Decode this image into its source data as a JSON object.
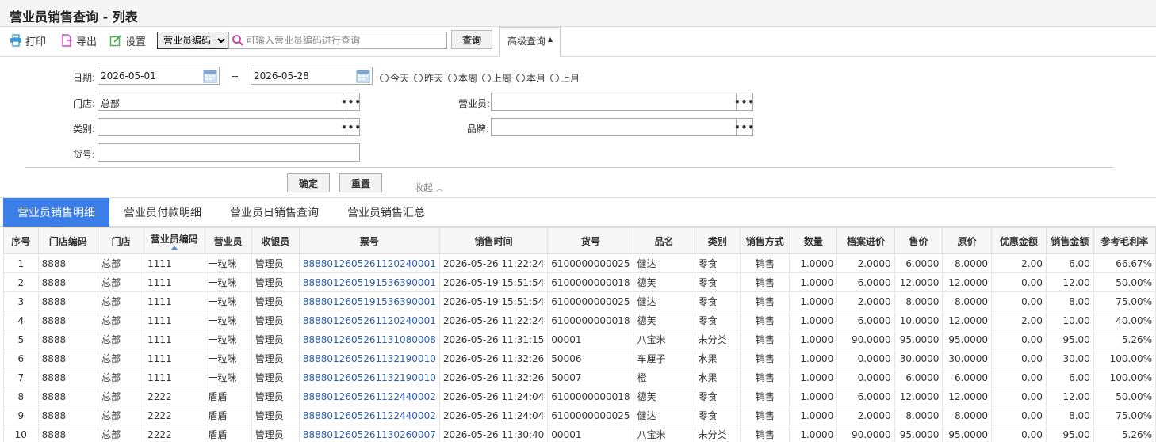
{
  "title": "营业员销售查询 - 列表",
  "toolbar": {
    "print": "打印",
    "export": "导出",
    "settings": "设置",
    "field_select": "营业员编码",
    "search_placeholder": "可输入营业员编码进行查询",
    "query_button": "查询",
    "advanced_tab": "高级查询"
  },
  "form": {
    "date_label": "日期:",
    "date_from": "2026-05-01",
    "date_sep": "--",
    "date_to": "2026-05-28",
    "quick_ranges": [
      "今天",
      "昨天",
      "本周",
      "上周",
      "本月",
      "上月"
    ],
    "store_label": "门店:",
    "store_value": "总部",
    "clerk_label": "营业员:",
    "clerk_value": "",
    "category_label": "类别:",
    "category_value": "",
    "brand_label": "品牌:",
    "brand_value": "",
    "sku_label": "货号:",
    "sku_value": "",
    "ok_button": "确定",
    "reset_button": "重置",
    "collapse": "收起"
  },
  "tabs": [
    "营业员销售明细",
    "营业员付款明细",
    "营业员日销售查询",
    "营业员销售汇总"
  ],
  "table": {
    "headers": [
      "序号",
      "门店编码",
      "门店",
      "营业员编码",
      "营业员",
      "收银员",
      "票号",
      "销售时间",
      "货号",
      "品名",
      "类别",
      "销售方式",
      "数量",
      "档案进价",
      "售价",
      "原价",
      "优惠金额",
      "销售金额",
      "参考毛利率"
    ],
    "rows": [
      [
        "1",
        "8888",
        "总部",
        "1111",
        "一粒咪",
        "管理员",
        "888801260526112024000​1",
        "2026-05-26 11:22:24",
        "6100000000025",
        "健达",
        "零食",
        "销售",
        "1.0000",
        "2.0000",
        "6.0000",
        "8.0000",
        "2.00",
        "6.00",
        "66.67%"
      ],
      [
        "2",
        "8888",
        "总部",
        "1111",
        "一粒咪",
        "管理员",
        "8888012605191536390001",
        "2026-05-19 15:51:54",
        "6100000000018",
        "德芙",
        "零食",
        "销售",
        "1.0000",
        "6.0000",
        "12.0000",
        "12.0000",
        "0.00",
        "12.00",
        "50.00%"
      ],
      [
        "3",
        "8888",
        "总部",
        "1111",
        "一粒咪",
        "管理员",
        "8888012605191536390001",
        "2026-05-19 15:51:54",
        "6100000000025",
        "健达",
        "零食",
        "销售",
        "1.0000",
        "2.0000",
        "8.0000",
        "8.0000",
        "0.00",
        "8.00",
        "75.00%"
      ],
      [
        "4",
        "8888",
        "总部",
        "1111",
        "一粒咪",
        "管理员",
        "8888012605261120240001",
        "2026-05-26 11:22:24",
        "6100000000018",
        "德芙",
        "零食",
        "销售",
        "1.0000",
        "6.0000",
        "10.0000",
        "12.0000",
        "2.00",
        "10.00",
        "40.00%"
      ],
      [
        "5",
        "8888",
        "总部",
        "1111",
        "一粒咪",
        "管理员",
        "8888012605261131080008",
        "2026-05-26 11:31:15",
        "00001",
        "八宝米",
        "未分类",
        "销售",
        "1.0000",
        "90.0000",
        "95.0000",
        "95.0000",
        "0.00",
        "95.00",
        "5.26%"
      ],
      [
        "6",
        "8888",
        "总部",
        "1111",
        "一粒咪",
        "管理员",
        "8888012605261132190010",
        "2026-05-26 11:32:26",
        "50006",
        "车厘子",
        "水果",
        "销售",
        "1.0000",
        "0.0000",
        "30.0000",
        "30.0000",
        "0.00",
        "30.00",
        "100.00%"
      ],
      [
        "7",
        "8888",
        "总部",
        "1111",
        "一粒咪",
        "管理员",
        "8888012605261132190010",
        "2026-05-26 11:32:26",
        "50007",
        "橙",
        "水果",
        "销售",
        "1.0000",
        "0.0000",
        "6.0000",
        "6.0000",
        "0.00",
        "6.00",
        "100.00%"
      ],
      [
        "8",
        "8888",
        "总部",
        "2222",
        "盾盾",
        "管理员",
        "8888012605261122440002",
        "2026-05-26 11:24:04",
        "6100000000018",
        "德芙",
        "零食",
        "销售",
        "1.0000",
        "6.0000",
        "12.0000",
        "12.0000",
        "0.00",
        "12.00",
        "50.00%"
      ],
      [
        "9",
        "8888",
        "总部",
        "2222",
        "盾盾",
        "管理员",
        "8888012605261122440002",
        "2026-05-26 11:24:04",
        "6100000000025",
        "健达",
        "零食",
        "销售",
        "1.0000",
        "2.0000",
        "8.0000",
        "8.0000",
        "0.00",
        "8.00",
        "75.00%"
      ],
      [
        "10",
        "8888",
        "总部",
        "2222",
        "盾盾",
        "管理员",
        "8888012605261130260007",
        "2026-05-26 11:30:40",
        "00001",
        "八宝米",
        "未分类",
        "销售",
        "1.0000",
        "90.0000",
        "95.0000",
        "95.0000",
        "0.00",
        "95.00",
        "5.26%"
      ]
    ]
  }
}
